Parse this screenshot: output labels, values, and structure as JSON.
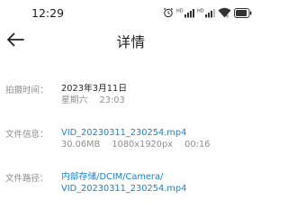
{
  "status_bar": {
    "time": "12:29",
    "wifi_label": "6",
    "battery_level": 0.9
  },
  "header": {
    "title": "详情"
  },
  "details": {
    "capture_time": {
      "label": "拍摄时间：",
      "date": "2023年3月11日",
      "weekday": "星期六",
      "time": "23:03"
    },
    "file_info": {
      "label": "文件信息：",
      "file_name": "VID_20230311_230254.mp4",
      "size": "30.06MB",
      "resolution": "1080x1920px",
      "duration": "00:16"
    },
    "file_path": {
      "label": "文件路径：",
      "path_line1": "内部存储/DCIM/Camera/",
      "path_line2": "VID_20230311_230254.mp4"
    }
  },
  "colors": {
    "link": "#1b7fd0",
    "label": "#8c8c8c",
    "text": "#262626"
  }
}
